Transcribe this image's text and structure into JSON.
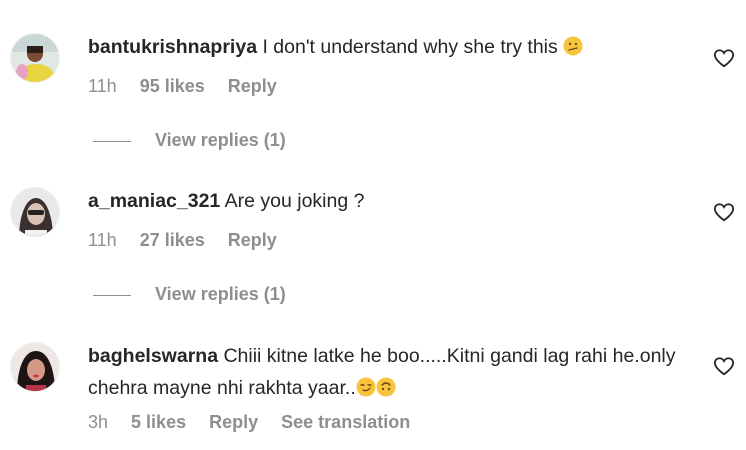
{
  "comments": [
    {
      "username": "bantukrishnapriya",
      "text": "I don't understand why she try this",
      "emoji": [
        "confused-face"
      ],
      "time": "11h",
      "likes": "95 likes",
      "reply": "Reply",
      "view_replies": "View replies (1)"
    },
    {
      "username": "a_maniac_321",
      "text": "Are you joking ?",
      "emoji": [],
      "time": "11h",
      "likes": "27 likes",
      "reply": "Reply",
      "view_replies": "View replies (1)"
    },
    {
      "username": "baghelswarna",
      "text": "Chiii kitne latke he boo.....Kitni gandi lag rahi he.only chehra mayne nhi rakhta yaar..",
      "emoji": [
        "smirking-face",
        "upside-down-face"
      ],
      "time": "3h",
      "likes": "5 likes",
      "reply": "Reply",
      "translation": "See translation"
    }
  ],
  "icons": {
    "like": "heart-outline-icon"
  },
  "colors": {
    "text": "#262626",
    "secondary": "#8e8e8e",
    "emoji": "#f7c43b"
  }
}
